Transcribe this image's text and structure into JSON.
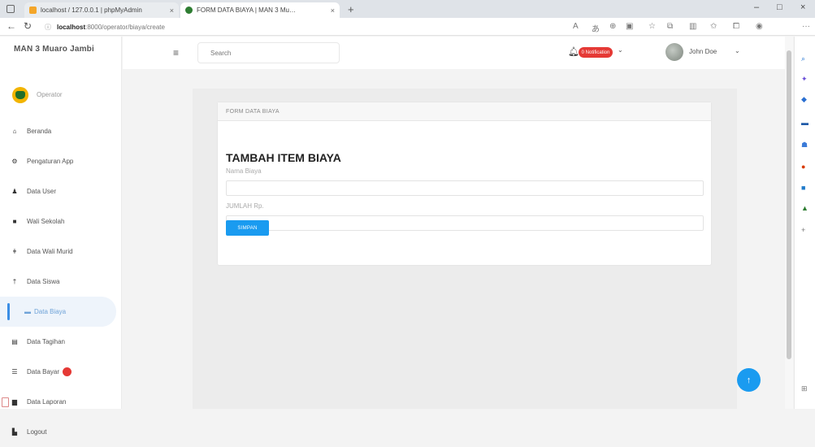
{
  "browser": {
    "tabs": [
      {
        "title": "localhost / 127.0.0.1 | phpMyAdmin"
      },
      {
        "title": "FORM DATA BIAYA | MAN 3 Mu…"
      }
    ],
    "new_tab": "+",
    "url_host": "localhost",
    "url_path": ":8000/operator/biaya/create",
    "window_controls": {
      "minimize": "–",
      "maximize": "□",
      "close": "×"
    }
  },
  "sidebar": {
    "brand": "MAN 3 Muaro Jambi",
    "user_role": "Operator",
    "items": [
      {
        "label": "Beranda",
        "icon": "home-icon"
      },
      {
        "label": "Pengaturan App",
        "icon": "gear-icon"
      },
      {
        "label": "Data User",
        "icon": "user-icon"
      },
      {
        "label": "Wali Sekolah",
        "icon": "building-icon"
      },
      {
        "label": "Data Wali Murid",
        "icon": "person-icon"
      },
      {
        "label": "Data Siswa",
        "icon": "student-icon"
      },
      {
        "label": "Data Biaya",
        "icon": "money-icon",
        "active": true
      },
      {
        "label": "Data Tagihan",
        "icon": "list-icon"
      },
      {
        "label": "Data Bayar",
        "icon": "payment-icon",
        "badge": true
      },
      {
        "label": "Data Laporan",
        "icon": "report-icon"
      },
      {
        "label": "Logout",
        "icon": "logout-icon"
      }
    ]
  },
  "header": {
    "search_placeholder": "Search",
    "notification_label": "0 Notification",
    "user_name": "John Doe"
  },
  "card": {
    "header": "FORM DATA BIAYA",
    "title": "TAMBAH ITEM BIAYA",
    "field1_label": "Nama Biaya",
    "field1_value": "",
    "field2_label": "JUMLAH Rp.",
    "field2_value": "",
    "submit_label": "SIMPAN"
  },
  "colors": {
    "accent": "#1a9bf0",
    "danger": "#e53935",
    "active_bg": "#eef4fb"
  }
}
